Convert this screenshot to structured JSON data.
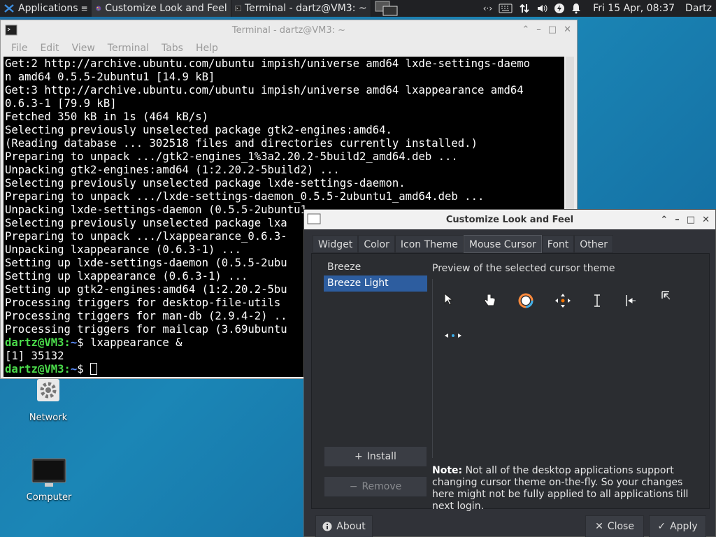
{
  "taskbar": {
    "apps_label": "Applications",
    "tasks": [
      {
        "label": "Customize Look and Feel",
        "icon": "palette-icon"
      },
      {
        "label": "Terminal - dartz@VM3: ~",
        "icon": "terminal-icon"
      }
    ],
    "clock": "Fri 15 Apr, 08:37",
    "user": "Dartz"
  },
  "desktop": {
    "icons": [
      {
        "label": "Network",
        "icon": "gear-icon"
      },
      {
        "label": "Computer",
        "icon": "monitor-icon"
      }
    ]
  },
  "terminal": {
    "title": "Terminal - dartz@VM3: ~",
    "menu": [
      "File",
      "Edit",
      "View",
      "Terminal",
      "Tabs",
      "Help"
    ],
    "lines": [
      "Get:2 http://archive.ubuntu.com/ubuntu impish/universe amd64 lxde-settings-daemo",
      "n amd64 0.5.5-2ubuntu1 [14.9 kB]",
      "Get:3 http://archive.ubuntu.com/ubuntu impish/universe amd64 lxappearance amd64",
      "0.6.3-1 [79.9 kB]",
      "Fetched 350 kB in 1s (464 kB/s)",
      "Selecting previously unselected package gtk2-engines:amd64.",
      "(Reading database ... 302518 files and directories currently installed.)",
      "Preparing to unpack .../gtk2-engines_1%3a2.20.2-5build2_amd64.deb ...",
      "Unpacking gtk2-engines:amd64 (1:2.20.2-5build2) ...",
      "Selecting previously unselected package lxde-settings-daemon.",
      "Preparing to unpack .../lxde-settings-daemon_0.5.5-2ubuntu1_amd64.deb ...",
      "Unpacking lxde-settings-daemon (0.5.5-2ubuntu1",
      "Selecting previously unselected package lxa",
      "Preparing to unpack .../lxappearance_0.6.3-",
      "Unpacking lxappearance (0.6.3-1) ...",
      "Setting up lxde-settings-daemon (0.5.5-2ubu",
      "Setting up lxappearance (0.6.3-1) ...",
      "Setting up gtk2-engines:amd64 (1:2.20.2-5bu",
      "Processing triggers for desktop-file-utils",
      "Processing triggers for man-db (2.9.4-2) ..",
      "Processing triggers for mailcap (3.69ubuntu"
    ],
    "prompt_user": "dartz@VM3",
    "prompt_sep": ":",
    "prompt_path": "~",
    "prompt_end": "$ ",
    "command": "lxappearance &",
    "job_output": "[1] 35132"
  },
  "lxappearance": {
    "title": "Customize Look and Feel",
    "tabs": [
      "Widget",
      "Color",
      "Icon Theme",
      "Mouse Cursor",
      "Font",
      "Other"
    ],
    "active_tab": "Mouse Cursor",
    "themes": [
      "Breeze",
      "Breeze Light"
    ],
    "selected_theme": "Breeze Light",
    "install_label": "Install",
    "remove_label": "Remove",
    "preview_label": "Preview of the selected cursor theme",
    "note_bold": "Note:",
    "note_text": " Not all of the desktop applications support changing cursor theme on-the-fly. So your changes here might not be fully applied to all applications till next login.",
    "about_label": "About",
    "close_label": "Close",
    "apply_label": "Apply",
    "colors": {
      "selection": "#2d5d9f",
      "dialog_bg": "#303238"
    }
  }
}
